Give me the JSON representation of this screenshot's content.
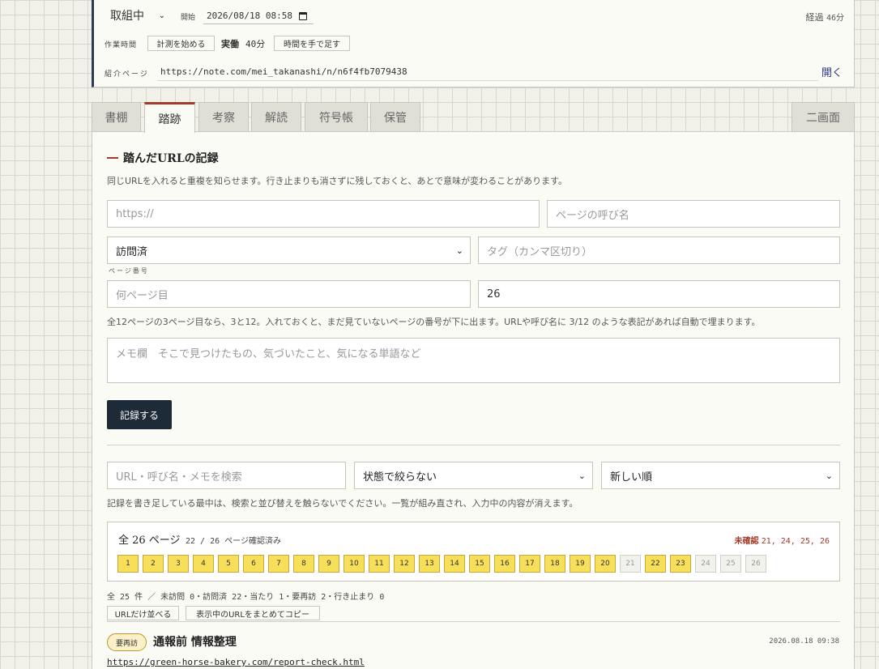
{
  "header": {
    "status_select": "取組中",
    "start_label": "開始",
    "start_value": "2026/08/18 08:58",
    "elapsed_label": "経過",
    "elapsed_value": "46分",
    "worktime_label": "作業時間",
    "start_timer_button": "計測を始める",
    "actual_label": "実働",
    "actual_value": "40分",
    "add_time_button": "時間を手で足す",
    "intro_label": "紹介ページ",
    "intro_url": "https://note.com/mei_takanashi/n/n6f4fb7079438",
    "open_link": "開く"
  },
  "tabs": [
    {
      "label": "書棚"
    },
    {
      "label": "踏跡"
    },
    {
      "label": "考察"
    },
    {
      "label": "解読"
    },
    {
      "label": "符号帳"
    },
    {
      "label": "保管"
    },
    {
      "label": "二画面"
    }
  ],
  "form": {
    "title": "踏んだURLの記録",
    "description": "同じURLを入れると重複を知らせます。行き止まりも消さずに残しておくと、あとで意味が変わることがあります。",
    "url_placeholder": "https://",
    "page_name_placeholder": "ページの呼び名",
    "status_value": "訪問済",
    "tags_placeholder": "タグ（カンマ区切り）",
    "page_number_label": "ページ番号",
    "page_number_placeholder": "何ページ目",
    "total_pages_value": "26",
    "page_hint": "全12ページの3ページ目なら、3と12。入れておくと、まだ見ていないページの番号が下に出ます。URLや呼び名に 3/12 のような表記があれば自動で埋まります。",
    "memo_placeholder": "メモ欄　そこで見つけたもの、気づいたこと、気になる単語など",
    "submit_button": "記録する"
  },
  "filters": {
    "search_placeholder": "URL・呼び名・メモを検索",
    "status_filter": "状態で絞らない",
    "sort_order": "新しい順",
    "warning": "記録を書き足している最中は、検索と並び替えを触らないでください。一覧が組み直され、入力中の内容が消えます。"
  },
  "pages": {
    "title": "全 26 ページ",
    "confirmed": "22 / 26 ページ確認済み",
    "unconfirmed_label": "未確認",
    "unconfirmed_value": "21, 24, 25, 26",
    "chips": [
      {
        "n": "1",
        "visited": true
      },
      {
        "n": "2",
        "visited": true
      },
      {
        "n": "3",
        "visited": true
      },
      {
        "n": "4",
        "visited": true
      },
      {
        "n": "5",
        "visited": true
      },
      {
        "n": "6",
        "visited": true
      },
      {
        "n": "7",
        "visited": true
      },
      {
        "n": "8",
        "visited": true
      },
      {
        "n": "9",
        "visited": true
      },
      {
        "n": "10",
        "visited": true
      },
      {
        "n": "11",
        "visited": true
      },
      {
        "n": "12",
        "visited": true
      },
      {
        "n": "13",
        "visited": true
      },
      {
        "n": "14",
        "visited": true
      },
      {
        "n": "15",
        "visited": true
      },
      {
        "n": "16",
        "visited": true
      },
      {
        "n": "17",
        "visited": true
      },
      {
        "n": "18",
        "visited": true
      },
      {
        "n": "19",
        "visited": true
      },
      {
        "n": "20",
        "visited": true
      },
      {
        "n": "21",
        "visited": false
      },
      {
        "n": "22",
        "visited": true
      },
      {
        "n": "23",
        "visited": true
      },
      {
        "n": "24",
        "visited": false
      },
      {
        "n": "25",
        "visited": false
      },
      {
        "n": "26",
        "visited": false
      }
    ]
  },
  "summary": "全 25 件 ／ 未訪問 0・訪問済 22・当たり 1・要再訪 2・行き止まり 0",
  "list_buttons": {
    "urls_only": "URLだけ並べる",
    "copy_urls": "表示中のURLをまとめてコピー"
  },
  "entry": {
    "badge": "要再訪",
    "title": "通報前 情報整理",
    "time": "2026.08.18 09:38",
    "url": "https://green-horse-bakery.com/report-check.html"
  },
  "colors": {
    "accent": "#a33a2a",
    "primary": "#1d2a38",
    "chip_visited": "#f7df5a",
    "chip_unvisited": "#f2f2ec"
  }
}
